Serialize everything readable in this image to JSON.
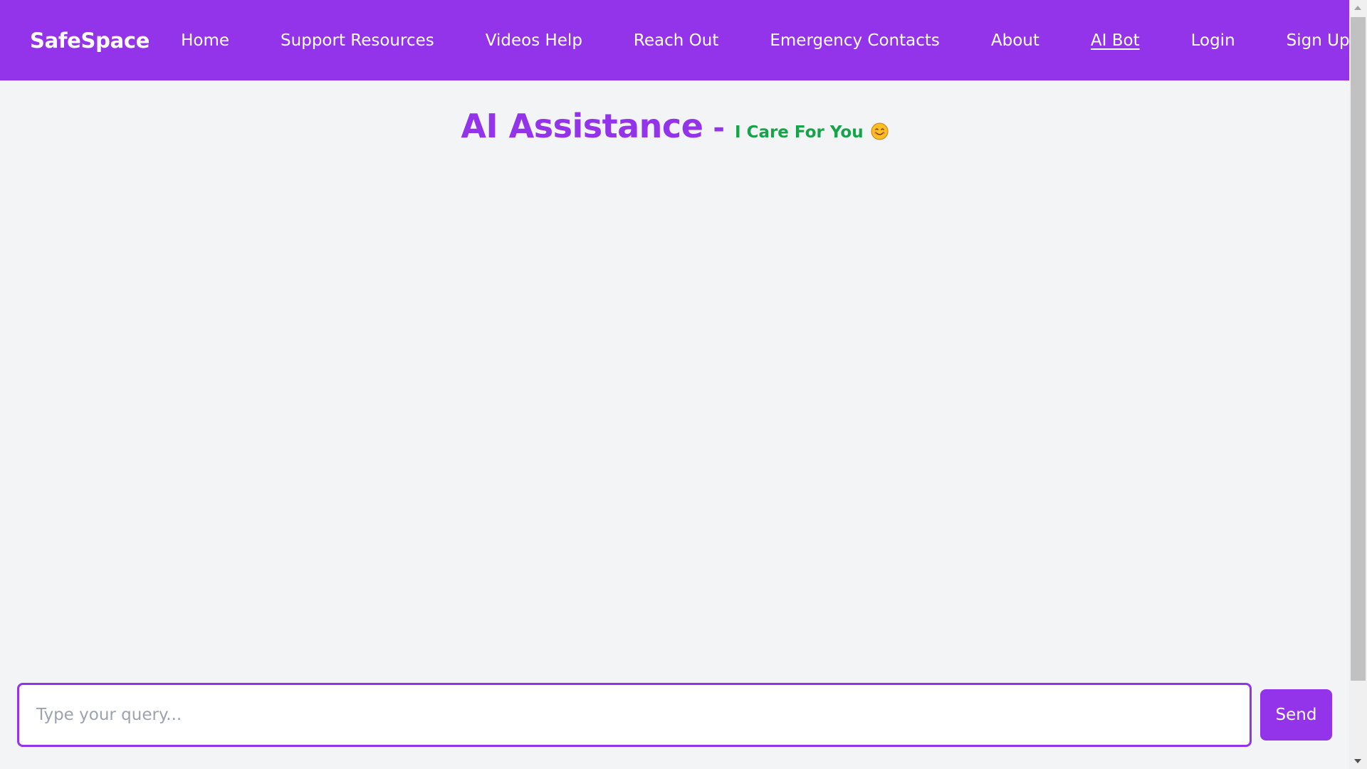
{
  "brand": {
    "name": "SafeSpace",
    "logo_icon": "heart-hands-logo"
  },
  "nav": {
    "items": [
      {
        "label": "Home",
        "active": false
      },
      {
        "label": "Support Resources",
        "active": false
      },
      {
        "label": "Videos Help",
        "active": false
      },
      {
        "label": "Reach Out",
        "active": false
      },
      {
        "label": "Emergency Contacts",
        "active": false
      },
      {
        "label": "About",
        "active": false
      },
      {
        "label": "AI Bot",
        "active": true
      },
      {
        "label": "Login",
        "active": false
      },
      {
        "label": "Sign Up",
        "active": false
      }
    ]
  },
  "main": {
    "title": "AI Assistance",
    "separator": "-",
    "subtitle": "I Care For You",
    "subtitle_icon": "smile-emoji-icon"
  },
  "chat": {
    "input_value": "",
    "placeholder": "Type your query...",
    "send_label": "Send"
  },
  "colors": {
    "accent": "#9333ea",
    "subtitle": "#16a34a",
    "background": "#f3f4f6"
  }
}
